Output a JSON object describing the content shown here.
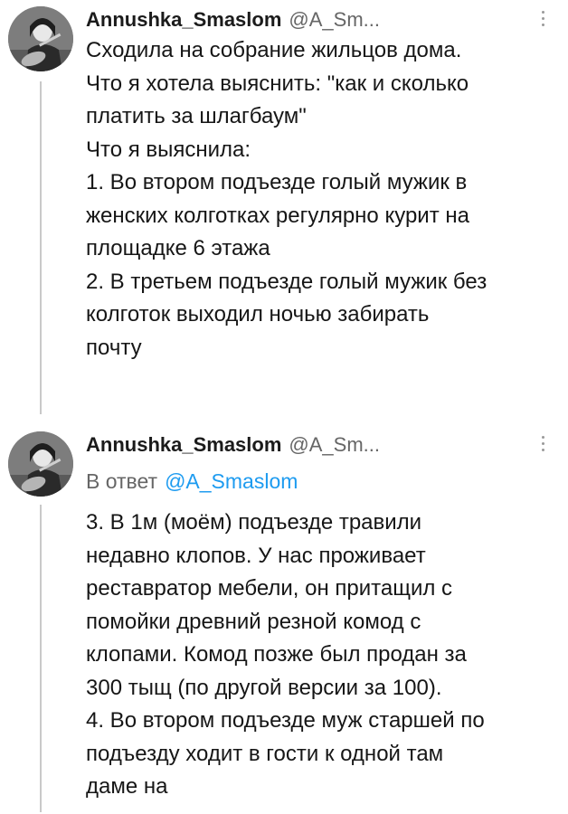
{
  "tweets": [
    {
      "author": {
        "name": "Annushka_Smaslom",
        "handle": "@A_Sm..."
      },
      "lines": [
        "Сходила на собрание жильцов дома.",
        "Что я хотела выяснить: \"как и сколько",
        "платить за шлагбаум\"",
        "Что я выяснила:",
        "1. Во втором подъезде голый мужик в",
        "женских колготках регулярно курит на",
        "площадке 6 этажа",
        "2. В третьем подъезде голый мужик без",
        "колготок выходил ночью забирать",
        "почту"
      ]
    },
    {
      "author": {
        "name": "Annushka_Smaslom",
        "handle": "@A_Sm..."
      },
      "reply": {
        "prefix": "В ответ",
        "mention": "@A_Smaslom"
      },
      "lines": [
        "3. В 1м (моём) подъезде травили",
        "недавно клопов. У нас проживает",
        "реставратор мебели, он притащил с",
        "помойки древний резной комод с",
        "клопами. Комод позже был продан за",
        "300 тыщ (по другой версии за 100).",
        "4. Во втором подъезде муж старшей по",
        "подъезду ходит в гости к одной там",
        "даме на"
      ]
    }
  ],
  "icons": {
    "avatar": "avatar-photo",
    "more": "more-options-icon"
  },
  "colors": {
    "link": "#1d9bf0",
    "muted": "#666666",
    "thread_line": "#c9c9c9"
  }
}
